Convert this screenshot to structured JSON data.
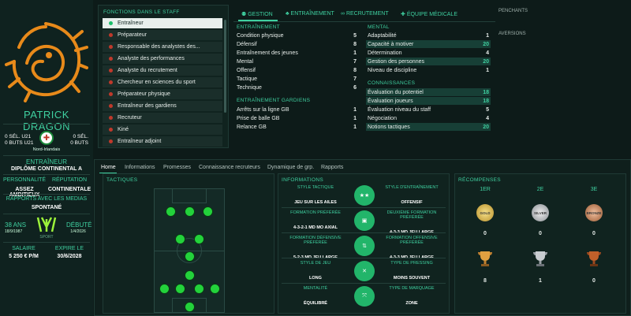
{
  "profile": {
    "name": "PATRICK DRAGON",
    "u21_left": "0 SÉL. U21",
    "goals_left": "0 BUTS U21",
    "u21_right": "0 SÉL.",
    "goals_right": "0 BUTS",
    "nation": "Nord-Irlandais",
    "role": "ENTRAÎNEUR",
    "diploma": "DIPLÔME CONTINENTAL A",
    "personality_label": "PERSONNALITÉ",
    "personality": "ASSEZ AMBITIEUX",
    "reputation_label": "RÉPUTATION",
    "reputation": "CONTINENTALE",
    "media_label": "RAPPORTS AVEC LES MEDIAS",
    "media": "SPONTANÉ",
    "age": "38 ANS",
    "birth": "18/9/1987",
    "debut_label": "DÉBUTÉ",
    "debut": "1/4/2026",
    "salary_label": "SALAIRE",
    "salary": "5 250 € P/M",
    "expire_label": "EXPIRE LE",
    "expire": "30/6/2028",
    "sponsor": "SPORT"
  },
  "staff": {
    "title": "FONCTIONS DANS LE STAFF",
    "items": [
      {
        "label": "Entraîneur",
        "selected": true
      },
      {
        "label": "Préparateur"
      },
      {
        "label": "Responsable des analystes des..."
      },
      {
        "label": "Analyste des performances"
      },
      {
        "label": "Analyste du recrutement"
      },
      {
        "label": "Chercheur en sciences du sport"
      },
      {
        "label": "Préparateur physique"
      },
      {
        "label": "Entraîneur des gardiens"
      },
      {
        "label": "Recruteur"
      },
      {
        "label": "Kiné"
      },
      {
        "label": "Entraîneur adjoint"
      }
    ]
  },
  "tabs": [
    "GESTION",
    "ENTRAÎNEMENT",
    "RECRUTEMENT",
    "ÉQUIPE MÉDICALE"
  ],
  "attributes": {
    "coaching_head": "ENTRAÎNEMENT",
    "coaching": [
      {
        "label": "Condition physique",
        "value": "5"
      },
      {
        "label": "Défensif",
        "value": "8"
      },
      {
        "label": "Entraînement des jeunes",
        "value": "1"
      },
      {
        "label": "Mental",
        "value": "7"
      },
      {
        "label": "Offensif",
        "value": "8"
      },
      {
        "label": "Tactique",
        "value": "7"
      },
      {
        "label": "Technique",
        "value": "6"
      }
    ],
    "gk_head": "ENTRAÎNEMENT GARDIENS",
    "gk": [
      {
        "label": "Arrêts sur la ligne GB",
        "value": "1"
      },
      {
        "label": "Prise de balle GB",
        "value": "1"
      },
      {
        "label": "Relance GB",
        "value": "1"
      }
    ],
    "mental_head": "MENTAL",
    "mental": [
      {
        "label": "Adaptabilité",
        "value": "1"
      },
      {
        "label": "Capacité à motiver",
        "value": "20"
      },
      {
        "label": "Détermination",
        "value": "4"
      },
      {
        "label": "Gestion des personnes",
        "value": "20"
      },
      {
        "label": "Niveau de discipline",
        "value": "1"
      }
    ],
    "knowledge_head": "CONNAISSANCES",
    "knowledge": [
      {
        "label": "Évaluation du potentiel",
        "value": "18"
      },
      {
        "label": "Évaluation joueurs",
        "value": "18"
      },
      {
        "label": "Évaluation niveau du staff",
        "value": "5"
      },
      {
        "label": "Négociation",
        "value": "4"
      },
      {
        "label": "Notions tactiques",
        "value": "20"
      }
    ]
  },
  "right_top": {
    "leanings": "PENCHANTS",
    "aversions": "AVERSIONS"
  },
  "subtabs": [
    "Home",
    "Informations",
    "Promesses",
    "Connaissance recruteurs",
    "Dynamique de grp.",
    "Rapports"
  ],
  "tactics_title": "TACTIQUES",
  "info": {
    "title": "INFORMATIONS",
    "rows": [
      {
        "l_label": "STYLE TACTIQUE",
        "l_value": "JEU SUR LES AILES",
        "r_label": "STYLE D'ENTRAÎNEMENT",
        "r_value": "OFFENSIF"
      },
      {
        "l_label": "FORMATION PRÉFÉRÉE",
        "l_value": "4-3-2-1 MD MO AXIAL",
        "r_label": "DEUXIÈME FORMATION PRÉFÉRÉE",
        "r_value": "4-3-3 MD JEU LARGE"
      },
      {
        "l_label": "FORMATION DÉFENSIVE PRÉFÉRÉE",
        "l_value": "5-2-3 MD JEU LARGE",
        "r_label": "FORMATION OFFENSIVE PRÉFÉRÉE",
        "r_value": "4-3-3 MD JEU LARGE"
      },
      {
        "l_label": "STYLE DE JEU",
        "l_value": "LONG",
        "r_label": "TYPE DE PRESSING",
        "r_value": "MOINS SOUVENT"
      },
      {
        "l_label": "MENTALITÉ",
        "l_value": "ÉQUILIBRÉ",
        "r_label": "TYPE DE MARQUAGE",
        "r_value": "ZONE"
      }
    ]
  },
  "rewards": {
    "title": "RÉCOMPENSES",
    "places": [
      "1ER",
      "2E",
      "3E"
    ],
    "medal_labels": [
      "GOLD",
      "SILVER",
      "BRONZE"
    ],
    "medals": [
      "0",
      "0",
      "0"
    ],
    "trophies": [
      "8",
      "1",
      "0"
    ]
  },
  "colors": {
    "accent": "#3fd0a0",
    "bg": "#0d1b19",
    "pitch_player": "#23d23b",
    "info_circle": "#22b56a"
  }
}
